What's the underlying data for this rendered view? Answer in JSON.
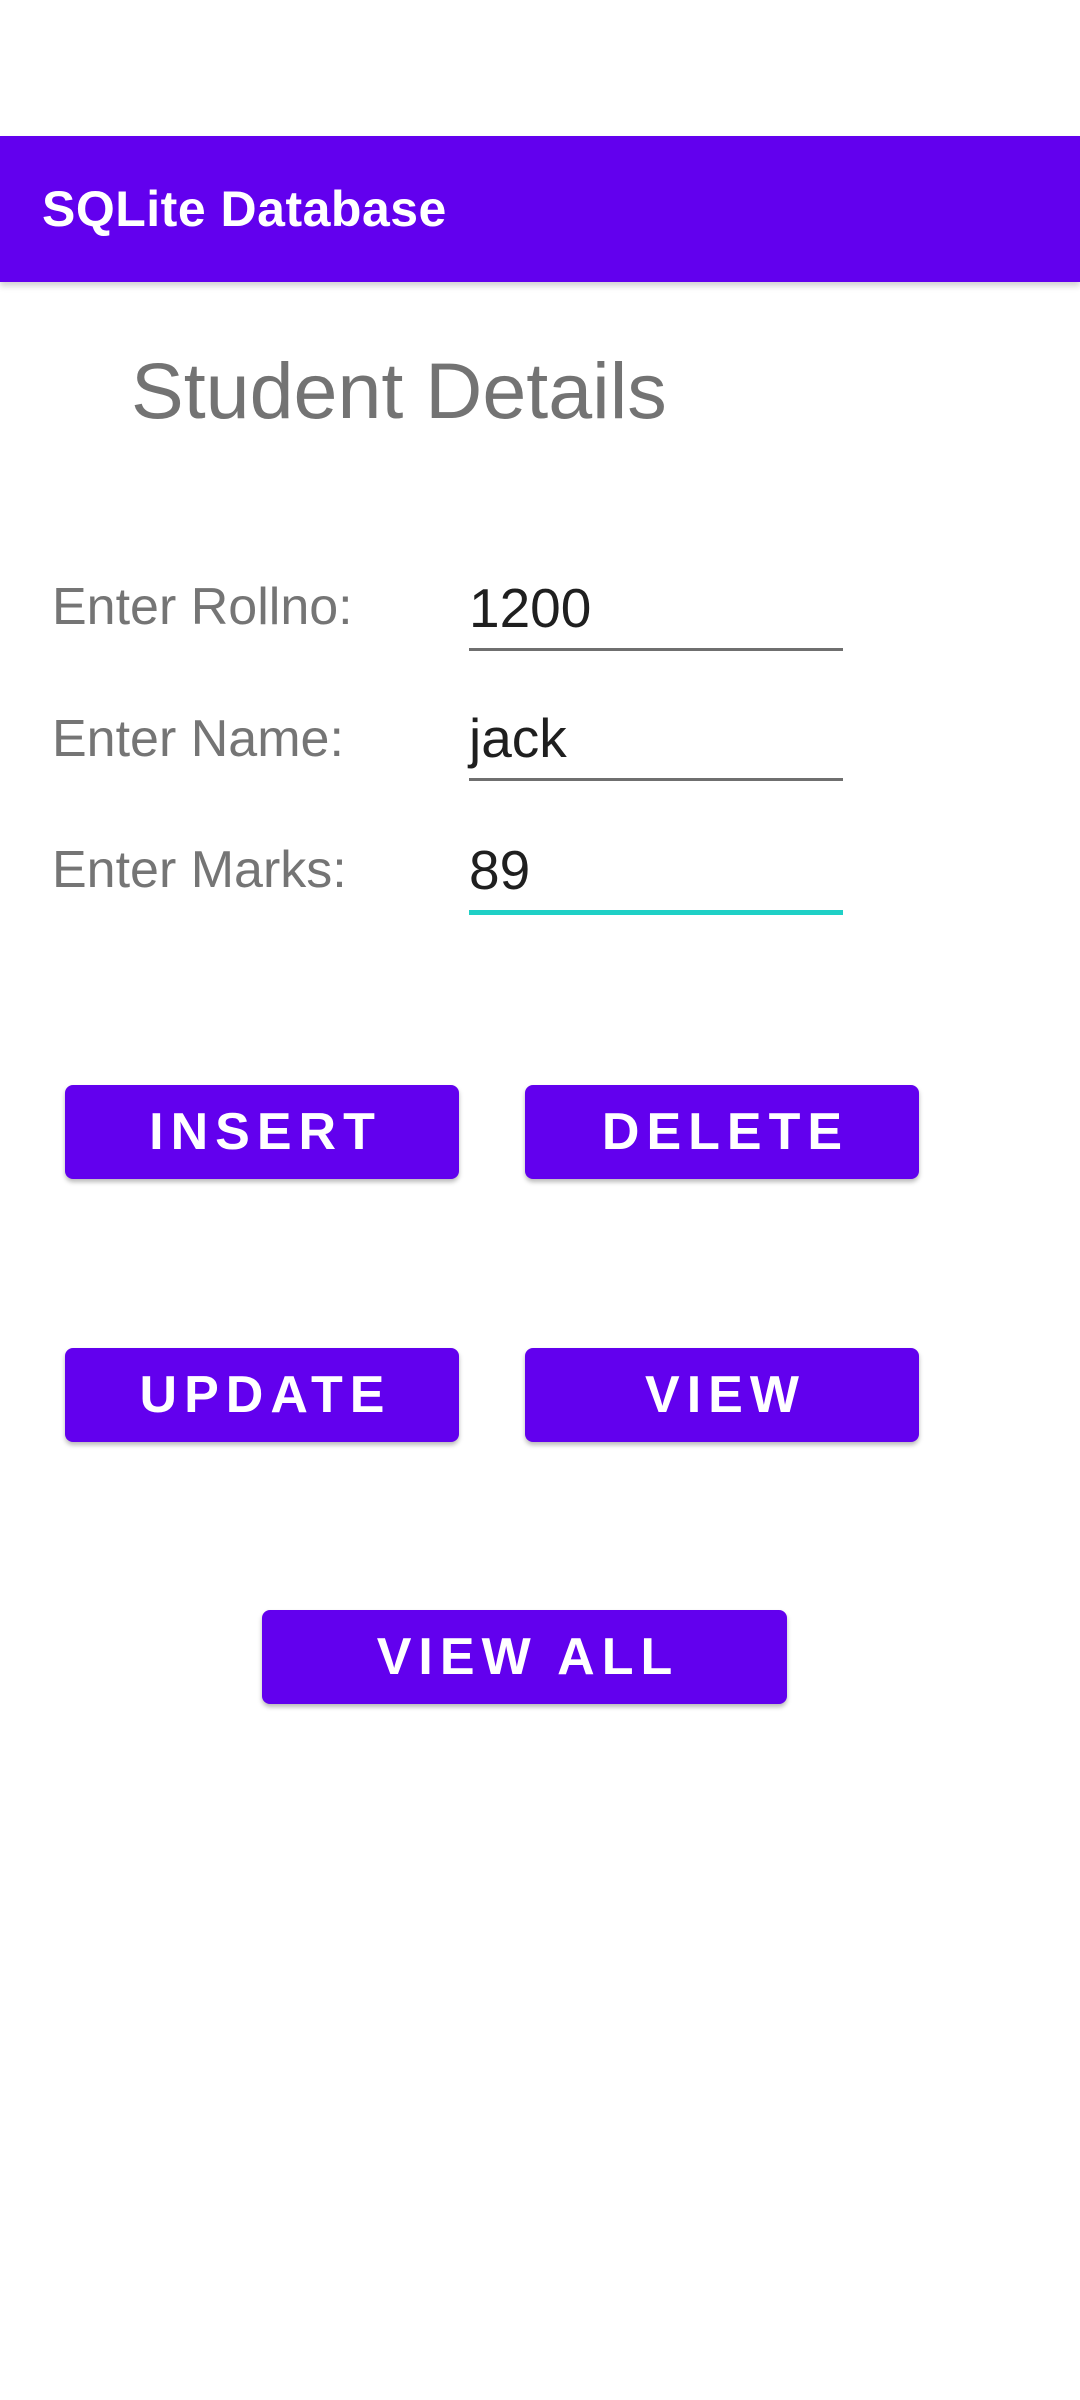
{
  "app_bar": {
    "title": "SQLite Database",
    "color": "#6200ee"
  },
  "page": {
    "title": "Student Details"
  },
  "form": {
    "rollno": {
      "label": "Enter Rollno:",
      "value": "1200"
    },
    "name": {
      "label": "Enter Name:",
      "value": "jack"
    },
    "marks": {
      "label": "Enter Marks:",
      "value": "89",
      "focused": true
    }
  },
  "buttons": {
    "insert": "INSERT",
    "delete": "DELETE",
    "update": "UPDATE",
    "view": "VIEW",
    "view_all": "VIEW ALL"
  },
  "colors": {
    "accent": "#6200ee",
    "focus_underline": "#1fd0c6"
  }
}
